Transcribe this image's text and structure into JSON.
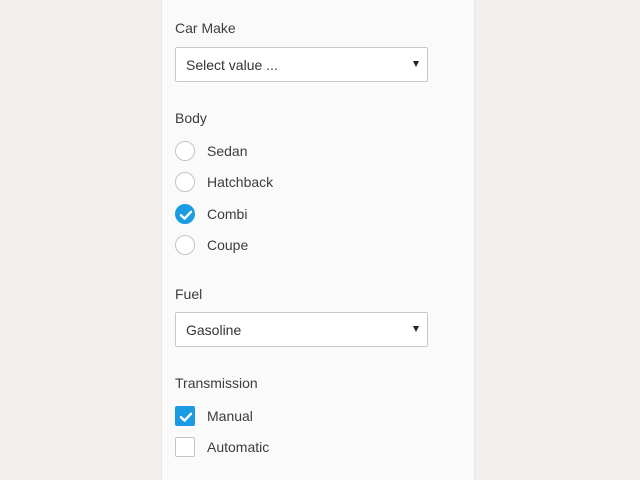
{
  "form": {
    "car_make": {
      "label": "Car Make",
      "selected": "Select value ..."
    },
    "body": {
      "label": "Body",
      "options": [
        {
          "label": "Sedan",
          "checked": false
        },
        {
          "label": "Hatchback",
          "checked": false
        },
        {
          "label": "Combi",
          "checked": true
        },
        {
          "label": "Coupe",
          "checked": false
        }
      ]
    },
    "fuel": {
      "label": "Fuel",
      "selected": "Gasoline"
    },
    "transmission": {
      "label": "Transmission",
      "options": [
        {
          "label": "Manual",
          "checked": true
        },
        {
          "label": "Automatic",
          "checked": false
        }
      ]
    }
  },
  "colors": {
    "accent": "#1a9ce3",
    "page_background": "#f1f0ee",
    "panel_background": "#fafafa"
  },
  "icons": {
    "select_arrow": "chevron-down-icon",
    "check": "check-icon"
  }
}
